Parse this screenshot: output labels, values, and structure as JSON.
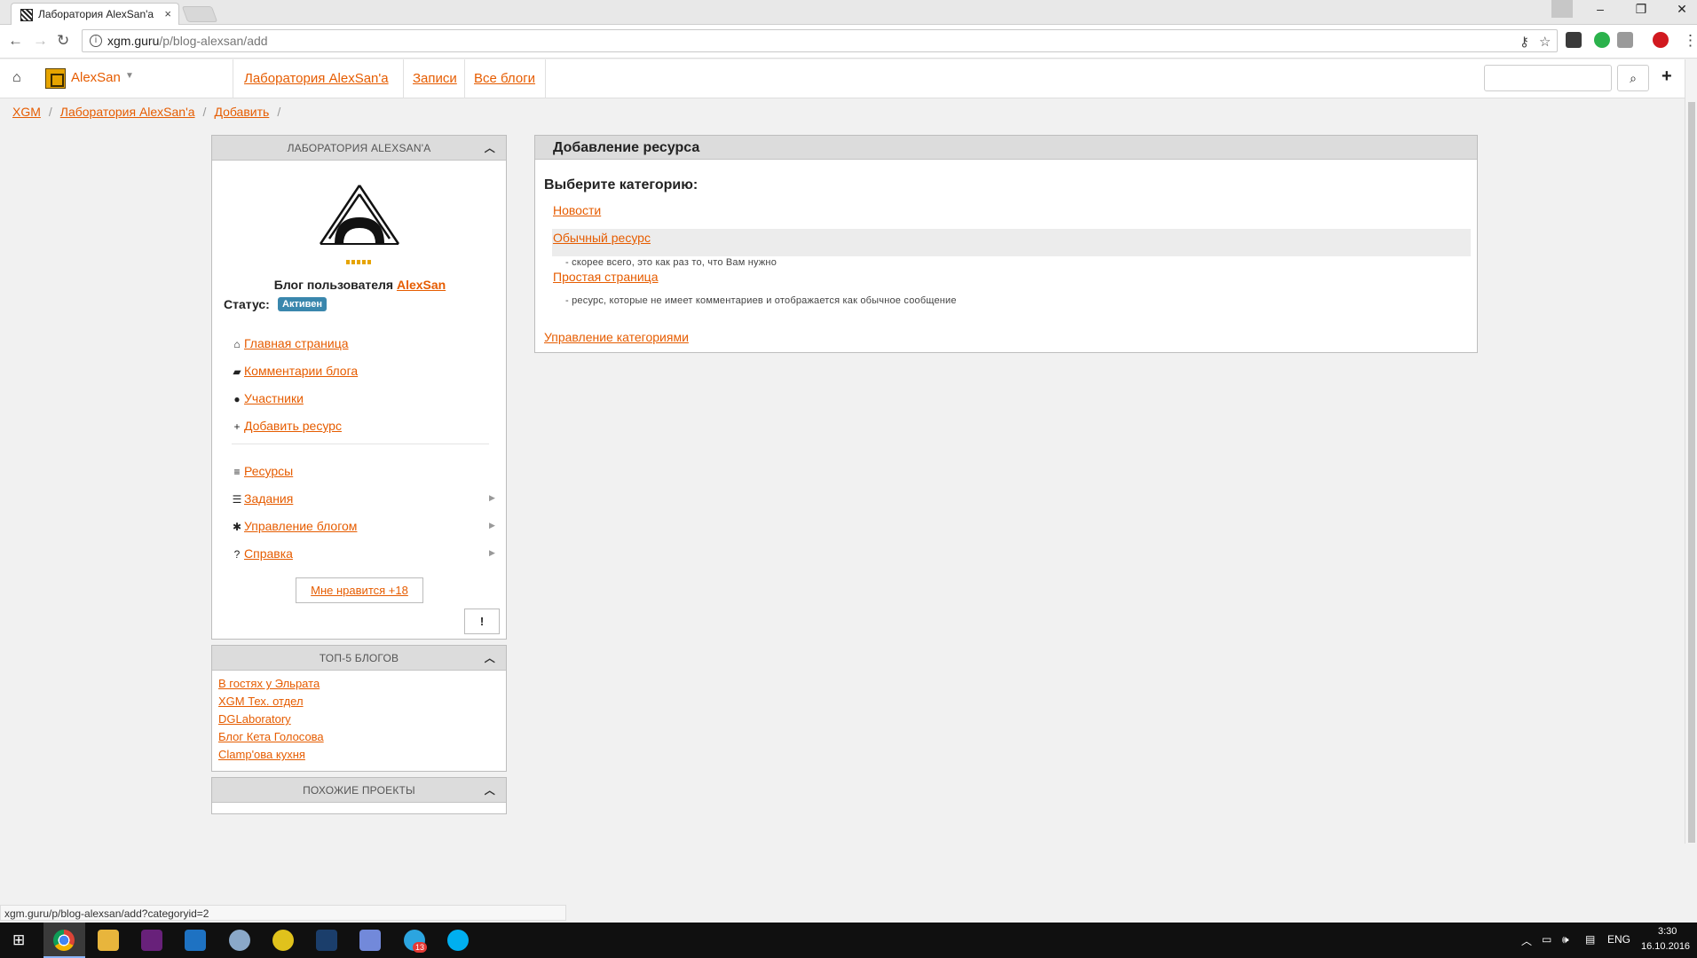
{
  "browser": {
    "tab_title": "Лаборатория AlexSan'a",
    "tab_close": "×",
    "url_host": "xgm.guru",
    "url_path": "/p/blog-alexsan/add",
    "status_url": "xgm.guru/p/blog-alexsan/add?categoryid=2"
  },
  "site_header": {
    "username": "AlexSan",
    "nav": [
      "Лаборатория AlexSan'a",
      "Записи",
      "Все блоги"
    ],
    "search_placeholder": ""
  },
  "breadcrumb": [
    "XGM",
    "Лаборатория AlexSan'a",
    "Добавить"
  ],
  "sidebar": {
    "panel_title": "ЛАБОРАТОРИЯ ALEXSAN'A",
    "blog_owner_prefix": "Блог пользователя",
    "blog_owner": "AlexSan",
    "status_label": "Статус:",
    "status_value": "Активен",
    "menu": [
      {
        "label": "Главная страница",
        "icon": "home-icon"
      },
      {
        "label": "Комментарии блога",
        "icon": "comment-icon"
      },
      {
        "label": "Участники",
        "icon": "user-icon"
      },
      {
        "label": "Добавить ресурс",
        "icon": "plus-icon"
      }
    ],
    "menu2": [
      {
        "label": "Ресурсы",
        "icon": "list-icon"
      },
      {
        "label": "Задания",
        "icon": "tasks-icon"
      },
      {
        "label": "Управление блогом",
        "icon": "gear-icon"
      },
      {
        "label": "Справка",
        "icon": "question-icon"
      }
    ],
    "like_button": "Мне нравится +18",
    "report_button": "!"
  },
  "top5": {
    "title": "ТОП-5 БЛОГОВ",
    "items": [
      "В гостях у Эльрата",
      "XGM Тех. отдел",
      "DGLaboratory",
      "Блог Кета Голосова",
      "Clamp'ова кухня"
    ]
  },
  "similar": {
    "title": "ПОХОЖИЕ ПРОЕКТЫ"
  },
  "main": {
    "title": "Добавление ресурса",
    "choose": "Выберите категорию:",
    "categories": [
      {
        "label": "Новости",
        "desc": ""
      },
      {
        "label": "Обычный ресурс",
        "desc": "- скорее всего, это как раз то, что Вам нужно"
      },
      {
        "label": "Простая страница",
        "desc": "- ресурс, которые не имеет комментариев и отображается как обычное сообщение"
      }
    ],
    "manage_link": "Управление категориями"
  },
  "taskbar": {
    "lang": "ENG",
    "time": "3:30",
    "date": "16.10.2016",
    "telegram_badge": "13"
  },
  "colors": {
    "accent": "#e65c00",
    "badge": "#3a87ad",
    "taskbar": "#101010"
  }
}
